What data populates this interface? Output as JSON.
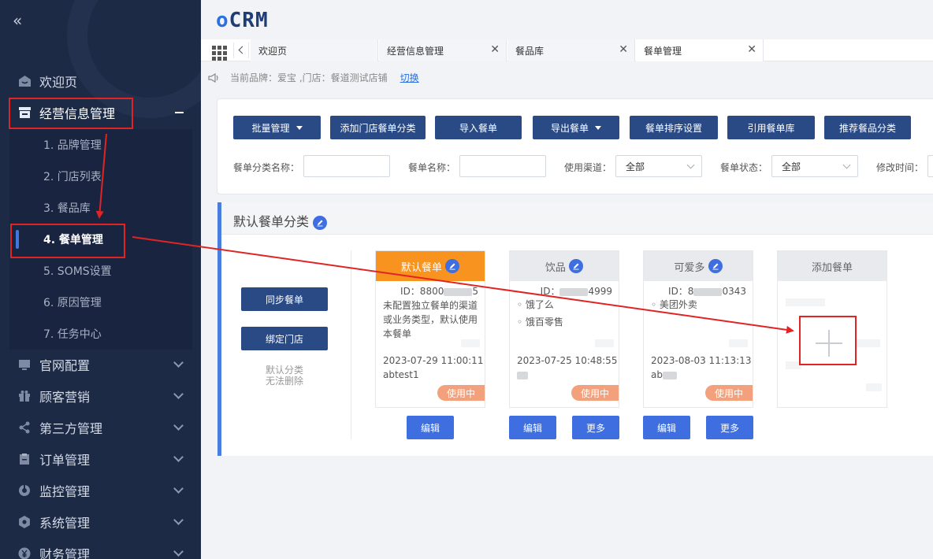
{
  "app": {
    "logo_prefix": "o",
    "logo_rest": "CRM"
  },
  "sidebar": {
    "collapse_glyph": "«",
    "items": [
      {
        "label": "欢迎页",
        "icon": "home-icon"
      },
      {
        "label": "经营信息管理",
        "icon": "store-icon"
      },
      {
        "label": "官网配置",
        "icon": "screen-icon"
      },
      {
        "label": "顾客营销",
        "icon": "gift-icon"
      },
      {
        "label": "第三方管理",
        "icon": "share-icon"
      },
      {
        "label": "订单管理",
        "icon": "clipboard-icon"
      },
      {
        "label": "监控管理",
        "icon": "monitor-icon"
      },
      {
        "label": "系统管理",
        "icon": "gear-icon"
      },
      {
        "label": "财务管理",
        "icon": "yen-icon"
      }
    ],
    "sub_items": [
      {
        "label": "1. 品牌管理"
      },
      {
        "label": "2. 门店列表"
      },
      {
        "label": "3. 餐品库"
      },
      {
        "label": "4. 餐单管理"
      },
      {
        "label": "5. SOMS设置"
      },
      {
        "label": "6. 原因管理"
      },
      {
        "label": "7. 任务中心"
      }
    ]
  },
  "tabs": [
    {
      "label": "欢迎页"
    },
    {
      "label": "经营信息管理"
    },
    {
      "label": "餐品库"
    },
    {
      "label": "餐单管理"
    }
  ],
  "close_glyph": "✕",
  "notice": {
    "text": "当前品牌：爱宝 ,门店：餐道测试店铺",
    "switch": "切换"
  },
  "toolbar": {
    "batch": "批量管理",
    "add_category": "添加门店餐单分类",
    "import": "导入餐单",
    "export": "导出餐单",
    "sort": "餐单排序设置",
    "reference": "引用餐单库",
    "recommend": "推荐餐品分类"
  },
  "filters": {
    "category_name": "餐单分类名称：",
    "menu_name": "餐单名称：",
    "channel": "使用渠道：",
    "channel_value": "全部",
    "status": "餐单状态：",
    "status_value": "全部",
    "modified": "修改时间："
  },
  "section": {
    "title": "默认餐单分类",
    "sync": "同步餐单",
    "bind": "绑定门店",
    "note1": "默认分类",
    "note2": "无法删除"
  },
  "cards": [
    {
      "name": "默认餐单",
      "id_prefix": "ID：8800",
      "id_suffix": "5",
      "desc": "未配置独立餐单的渠道或业务类型，默认使用本餐单",
      "date": "2023-07-29 11:00:11",
      "user": "abtest1",
      "badge": "使用中",
      "edit": "编辑"
    },
    {
      "name": "饮品",
      "id_prefix": "ID：",
      "id_suffix": "4999",
      "ch1": "◦ 饿了么",
      "ch2": "◦ 饿百零售",
      "date": "2023-07-25 10:48:55",
      "badge": "使用中",
      "edit": "编辑",
      "more": "更多"
    },
    {
      "name": "可爱多",
      "id_prefix": "ID：8",
      "id_suffix": "0343",
      "ch1": "◦ 美团外卖",
      "date": "2023-08-03 11:13:13",
      "user_prefix": "ab",
      "badge": "使用中",
      "edit": "编辑",
      "more": "更多"
    },
    {
      "name": "添加餐单"
    }
  ],
  "colors": {
    "sidebar_bg": "#1d2a45",
    "primary_button": "#2a4a86",
    "accent_blue": "#3e6ee0",
    "default_card": "#f7931e",
    "badge": "#f3a17c",
    "annotation": "#e02424"
  }
}
